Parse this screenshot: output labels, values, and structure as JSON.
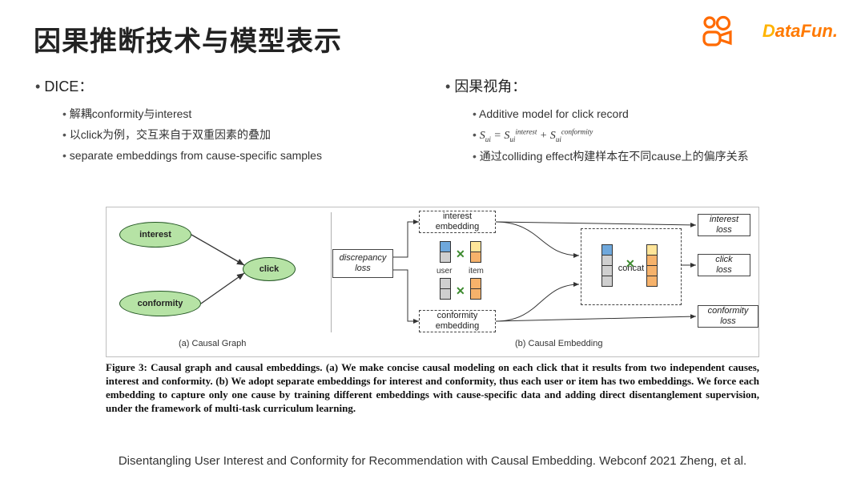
{
  "title": "因果推断技术与模型表示",
  "logos": {
    "datafun": "DataFun."
  },
  "left": {
    "heading": "DICE：",
    "items": [
      "解耦conformity与interest",
      "以click为例，交互来自于双重因素的叠加",
      "separate embeddings from cause-specific samples"
    ]
  },
  "right": {
    "heading": "因果视角：",
    "items": [
      "Additive model for click record",
      "",
      "通过colliding effect构建样本在不同cause上的偏序关系"
    ],
    "formula_parts": {
      "lhs_sub": "ui",
      "rhs1_sup": "interest",
      "rhs2_sup": "conformity"
    }
  },
  "figure": {
    "nodes": {
      "interest": "interest",
      "conformity": "conformity",
      "click": "click"
    },
    "boxes": {
      "interest_embedding_l1": "interest",
      "interest_embedding_l2": "embedding",
      "conformity_embedding_l1": "conformity",
      "conformity_embedding_l2": "embedding",
      "discrepancy_l1": "discrepancy",
      "discrepancy_l2": "loss",
      "concat": "concat",
      "interest_loss_l1": "interest",
      "interest_loss_l2": "loss",
      "click_loss_l1": "click",
      "click_loss_l2": "loss",
      "conformity_loss_l1": "conformity",
      "conformity_loss_l2": "loss"
    },
    "labels": {
      "user": "user",
      "item": "item"
    },
    "sub_captions": {
      "a": "(a) Causal Graph",
      "b": "(b) Causal Embedding"
    },
    "caption": "Figure 3: Causal graph and causal embeddings. (a) We make concise causal modeling on each click that it results from two independent causes, interest and conformity. (b) We adopt separate embeddings for interest and conformity, thus each user or item has two embeddings. We force each embedding to capture only one cause by training different embeddings with cause-specific data and adding direct disentanglement supervision, under the framework of multi-task curriculum learning."
  },
  "citation": "Disentangling User Interest and Conformity for Recommendation with Causal Embedding. Webconf 2021 Zheng, et al."
}
